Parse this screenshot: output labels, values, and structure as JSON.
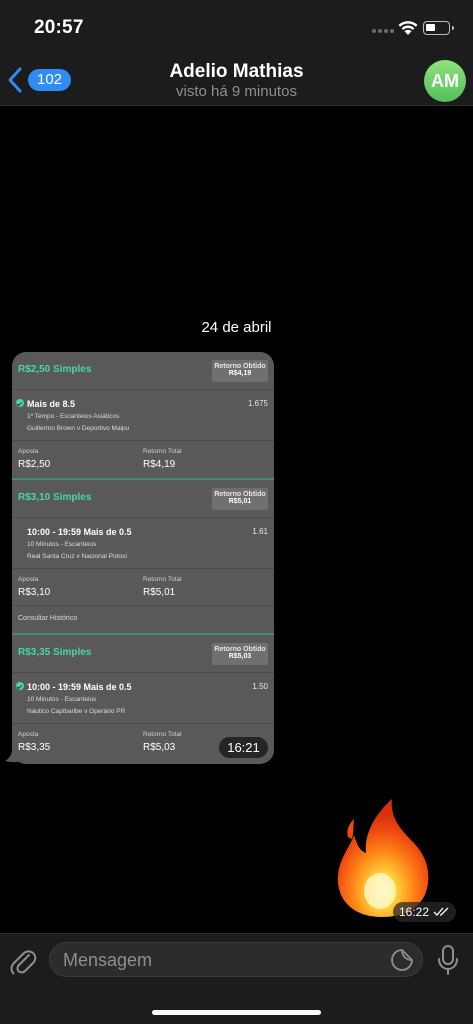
{
  "status_bar": {
    "time": "20:57"
  },
  "header": {
    "back_count": "102",
    "title": "Adelio Mathias",
    "subtitle": "visto há 9 minutos",
    "avatar_initials": "AM"
  },
  "chat": {
    "date_separator": "24 de abril",
    "photo_message": {
      "time": "16:21",
      "bets": [
        {
          "stake_label": "R$2,50 Simples",
          "return_label": "Retorno Obtido",
          "return_value": "R$4,19",
          "selection": "Mais de 8.5",
          "odds": "1.675",
          "market": "1º Tempo - Escanteios Asiáticos",
          "match": "Guillermo Brown v Deportivo Maipu",
          "bet_label": "Aposta",
          "bet_value": "R$2,50",
          "total_label": "Retorno Total",
          "total_value": "R$4,19"
        },
        {
          "stake_label": "R$3,10 Simples",
          "return_label": "Retorno Obtido",
          "return_value": "R$5,01",
          "selection": "10:00 - 19:59 Mais de 0.5",
          "odds": "1.61",
          "market": "10 Minutos - Escanteios",
          "match": "Real Santa Cruz v Nacional Potosí",
          "bet_label": "Aposta",
          "bet_value": "R$3,10",
          "total_label": "Retorno Total",
          "total_value": "R$5,01",
          "history_link": "Consultar Histórico"
        },
        {
          "stake_label": "R$3,35 Simples",
          "return_label": "Retorno Obtido",
          "return_value": "R$5,03",
          "selection": "10:00 - 19:59 Mais de 0.5",
          "odds": "1.50",
          "market": "10 Minutos - Escanteios",
          "match": "Náutico Capibaribe v Operário PR",
          "bet_label": "Aposta",
          "bet_value": "R$3,35",
          "total_label": "Retorno Total",
          "total_value": "R$5,03"
        }
      ]
    },
    "emoji_message": {
      "emoji": "fire-emoji",
      "time": "16:22"
    }
  },
  "input": {
    "placeholder": "Mensagem"
  },
  "colors": {
    "accent": "#2f8cf5",
    "bet_green": "#47d6a6",
    "avatar": "#6fd46a"
  }
}
